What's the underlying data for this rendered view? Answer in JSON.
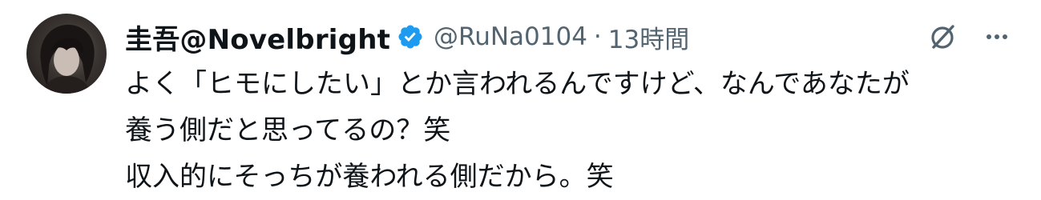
{
  "author": {
    "display_name": "圭吾@Novelbright",
    "handle": "@RuNa0104",
    "separator": "·",
    "timestamp": "13時間",
    "verified_icon": "verified-badge-icon",
    "avatar_icon": "avatar-photo"
  },
  "actions": {
    "grok_icon": "grok-slash-icon",
    "more_icon": "more-dots-icon"
  },
  "tweet": {
    "lines": [
      "よく「ヒモにしたい」とか言われるんですけど、なんであなたが",
      "養う側だと思ってるの？笑",
      "収入的にそっちが養われる側だから。笑"
    ]
  },
  "colors": {
    "text_primary": "#0f1419",
    "text_secondary": "#536471",
    "verified_blue": "#1d9bf0",
    "background": "#ffffff"
  }
}
